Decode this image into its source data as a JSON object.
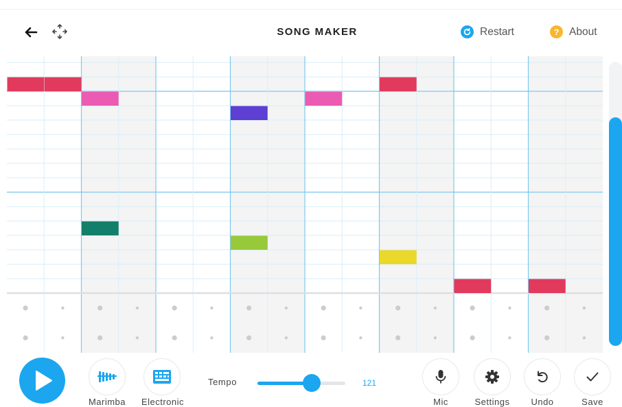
{
  "header": {
    "title": "SONG MAKER",
    "restart_label": "Restart",
    "about_label": "About",
    "about_icon": "?"
  },
  "grid": {
    "beats": 16,
    "beats_per_bar": 2,
    "melody_rows": 17,
    "percussion_rows": 2,
    "octave_lines_after_row": [
      3,
      10
    ],
    "notes": [
      {
        "beat": 0,
        "row": 2,
        "color": "#e23a5d"
      },
      {
        "beat": 1,
        "row": 2,
        "color": "#e23a5d"
      },
      {
        "beat": 2,
        "row": 3,
        "color": "#eb5bb3"
      },
      {
        "beat": 6,
        "row": 4,
        "color": "#5d3fd3"
      },
      {
        "beat": 8,
        "row": 3,
        "color": "#eb5bb3"
      },
      {
        "beat": 10,
        "row": 2,
        "color": "#e23a5d"
      },
      {
        "beat": 2,
        "row": 12,
        "color": "#127f6b"
      },
      {
        "beat": 6,
        "row": 13,
        "color": "#97c93a"
      },
      {
        "beat": 10,
        "row": 14,
        "color": "#ead82a"
      },
      {
        "beat": 12,
        "row": 16,
        "color": "#e23a5d"
      },
      {
        "beat": 14,
        "row": 16,
        "color": "#e23a5d"
      }
    ]
  },
  "controls": {
    "play_icon": "play-icon",
    "marimba_label": "Marimba",
    "electronic_label": "Electronic",
    "tempo_label": "Tempo",
    "tempo_value": "121",
    "tempo_fraction": 0.62,
    "mic_label": "Mic",
    "settings_label": "Settings",
    "undo_label": "Undo",
    "save_label": "Save"
  },
  "colors": {
    "accent": "#1ba6ef",
    "about_icon": "#f7b731",
    "shaded_bar": "#f4f4f4"
  },
  "scroll": {
    "position": 0.2
  }
}
